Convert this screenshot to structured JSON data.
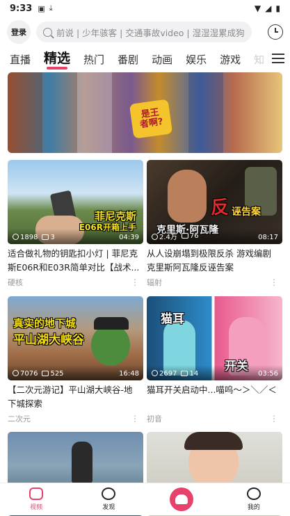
{
  "status_bar": {
    "time": "9:33",
    "icons": [
      "a-icon",
      "download-icon"
    ],
    "right_icons": [
      "wifi-icon",
      "signal-icon",
      "battery-icon"
    ]
  },
  "header": {
    "login_label": "登录",
    "search_placeholder": "前说 | 少年骇客 | 交通事故video | 湿湿湿累成狗",
    "history_icon": "history-clock-icon"
  },
  "tabs": [
    {
      "label": "直播"
    },
    {
      "label": "精选",
      "active": true
    },
    {
      "label": "热门"
    },
    {
      "label": "番剧"
    },
    {
      "label": "动画"
    },
    {
      "label": "娱乐"
    },
    {
      "label": "游戏"
    },
    {
      "label": "知"
    }
  ],
  "banner": {
    "logo_line1": "是王",
    "logo_line2": "者啊?"
  },
  "videos": [
    {
      "title": "适合做礼物的钥匙扣小灯 | 菲尼克斯E06R和E03R简单对比【战术...",
      "views": "1898",
      "danmaku": "3",
      "duration": "04:39",
      "author": "硬核",
      "cover_text_1": "菲尼克斯",
      "cover_text_2": "E06R开箱上手"
    },
    {
      "title": "从人设崩塌到极限反杀 游戏编剧克里斯阿瓦隆反诬告案",
      "views": "2.4万",
      "danmaku": "76",
      "duration": "08:17",
      "author": "辐射",
      "cover_text_1": "反",
      "cover_text_2": "诬告案",
      "cover_text_3": "克里斯·阿瓦隆"
    },
    {
      "title": "【二次元游记】平山湖大峡谷-地下城探索",
      "views": "7076",
      "danmaku": "525",
      "duration": "16:48",
      "author": "二次元",
      "cover_text_1": "真实的地下城",
      "cover_text_2": "平山湖大峡谷"
    },
    {
      "title": "猫耳开关启动中...喵呜～＞＼／＜",
      "views": "2697",
      "danmaku": "14",
      "duration": "03:56",
      "author": "初音",
      "cover_text_1": "猫耳",
      "cover_text_2": "开关"
    }
  ],
  "bottom_nav": [
    {
      "label": "视频",
      "icon": "video-icon",
      "active": true
    },
    {
      "label": "发现",
      "icon": "planet-icon"
    },
    {
      "label": "",
      "icon": "create-icon"
    },
    {
      "label": "我的",
      "icon": "profile-icon"
    }
  ],
  "colors": {
    "accent": "#e7426b"
  }
}
